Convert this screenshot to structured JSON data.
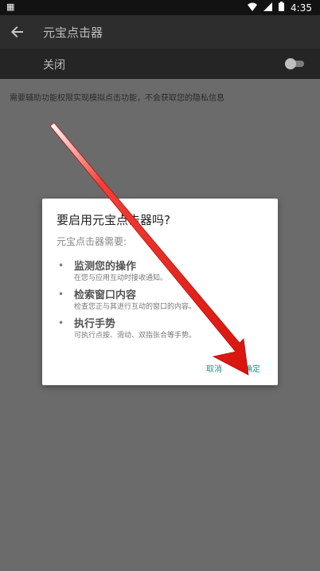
{
  "status_bar": {
    "time": "4:35",
    "left_icon": "image-icon",
    "icons": [
      "wifi-icon",
      "signal-icon",
      "battery-icon"
    ]
  },
  "toolbar": {
    "back_icon": "back-arrow-icon",
    "title": "元宝点击器"
  },
  "switch_bar": {
    "label": "关闭",
    "toggle_on": false
  },
  "description": "需要辅助功能权限实现模拟点击功能，不会获取您的隐私信息",
  "dialog": {
    "title": "要启用元宝点击器吗?",
    "subtitle": "元宝点击器需要:",
    "permissions": [
      {
        "title": "监测您的操作",
        "desc": "在您与应用互动时接收通知。"
      },
      {
        "title": "检索窗口内容",
        "desc": "检查您正与其进行互动的窗口的内容。"
      },
      {
        "title": "执行手势",
        "desc": "可执行点按、滑动、双指张合等手势。"
      }
    ],
    "cancel_label": "取消",
    "ok_label": "确定"
  },
  "colors": {
    "accent": "#14968a",
    "annotation_arrow": "#e8221c"
  }
}
